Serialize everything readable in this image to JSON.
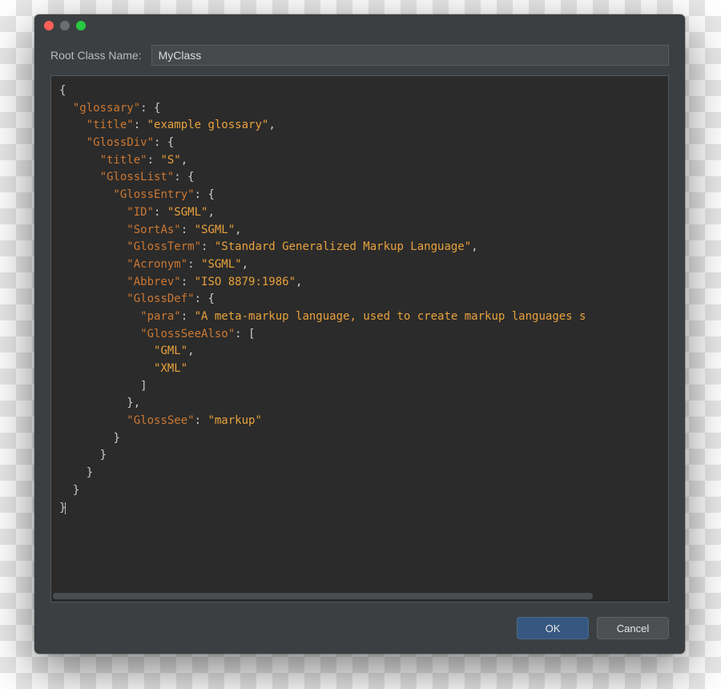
{
  "form": {
    "label": "Root Class Name:",
    "value": "MyClass"
  },
  "editor": {
    "lines": [
      {
        "indent": 0,
        "tokens": [
          {
            "t": "p",
            "v": "{"
          }
        ]
      },
      {
        "indent": 1,
        "tokens": [
          {
            "t": "k",
            "v": "\"glossary\""
          },
          {
            "t": "p",
            "v": ": {"
          }
        ]
      },
      {
        "indent": 2,
        "tokens": [
          {
            "t": "k",
            "v": "\"title\""
          },
          {
            "t": "p",
            "v": ": "
          },
          {
            "t": "s",
            "v": "\"example glossary\""
          },
          {
            "t": "p",
            "v": ","
          }
        ]
      },
      {
        "indent": 2,
        "tokens": [
          {
            "t": "k",
            "v": "\"GlossDiv\""
          },
          {
            "t": "p",
            "v": ": {"
          }
        ]
      },
      {
        "indent": 3,
        "tokens": [
          {
            "t": "k",
            "v": "\"title\""
          },
          {
            "t": "p",
            "v": ": "
          },
          {
            "t": "s",
            "v": "\"S\""
          },
          {
            "t": "p",
            "v": ","
          }
        ]
      },
      {
        "indent": 3,
        "tokens": [
          {
            "t": "k",
            "v": "\"GlossList\""
          },
          {
            "t": "p",
            "v": ": {"
          }
        ]
      },
      {
        "indent": 4,
        "tokens": [
          {
            "t": "k",
            "v": "\"GlossEntry\""
          },
          {
            "t": "p",
            "v": ": {"
          }
        ]
      },
      {
        "indent": 5,
        "tokens": [
          {
            "t": "k",
            "v": "\"ID\""
          },
          {
            "t": "p",
            "v": ": "
          },
          {
            "t": "s",
            "v": "\"SGML\""
          },
          {
            "t": "p",
            "v": ","
          }
        ]
      },
      {
        "indent": 5,
        "tokens": [
          {
            "t": "k",
            "v": "\"SortAs\""
          },
          {
            "t": "p",
            "v": ": "
          },
          {
            "t": "s",
            "v": "\"SGML\""
          },
          {
            "t": "p",
            "v": ","
          }
        ]
      },
      {
        "indent": 5,
        "tokens": [
          {
            "t": "k",
            "v": "\"GlossTerm\""
          },
          {
            "t": "p",
            "v": ": "
          },
          {
            "t": "s",
            "v": "\"Standard Generalized Markup Language\""
          },
          {
            "t": "p",
            "v": ","
          }
        ]
      },
      {
        "indent": 5,
        "tokens": [
          {
            "t": "k",
            "v": "\"Acronym\""
          },
          {
            "t": "p",
            "v": ": "
          },
          {
            "t": "s",
            "v": "\"SGML\""
          },
          {
            "t": "p",
            "v": ","
          }
        ]
      },
      {
        "indent": 5,
        "tokens": [
          {
            "t": "k",
            "v": "\"Abbrev\""
          },
          {
            "t": "p",
            "v": ": "
          },
          {
            "t": "s",
            "v": "\"ISO 8879:1986\""
          },
          {
            "t": "p",
            "v": ","
          }
        ]
      },
      {
        "indent": 5,
        "tokens": [
          {
            "t": "k",
            "v": "\"GlossDef\""
          },
          {
            "t": "p",
            "v": ": {"
          }
        ]
      },
      {
        "indent": 6,
        "tokens": [
          {
            "t": "k",
            "v": "\"para\""
          },
          {
            "t": "p",
            "v": ": "
          },
          {
            "t": "s",
            "v": "\"A meta-markup language, used to create markup languages s"
          }
        ]
      },
      {
        "indent": 6,
        "tokens": [
          {
            "t": "k",
            "v": "\"GlossSeeAlso\""
          },
          {
            "t": "p",
            "v": ": ["
          }
        ]
      },
      {
        "indent": 7,
        "tokens": [
          {
            "t": "s",
            "v": "\"GML\""
          },
          {
            "t": "p",
            "v": ","
          }
        ]
      },
      {
        "indent": 7,
        "tokens": [
          {
            "t": "s",
            "v": "\"XML\""
          }
        ]
      },
      {
        "indent": 6,
        "tokens": [
          {
            "t": "p",
            "v": "]"
          }
        ]
      },
      {
        "indent": 5,
        "tokens": [
          {
            "t": "p",
            "v": "},"
          }
        ]
      },
      {
        "indent": 5,
        "tokens": [
          {
            "t": "k",
            "v": "\"GlossSee\""
          },
          {
            "t": "p",
            "v": ": "
          },
          {
            "t": "s",
            "v": "\"markup\""
          }
        ]
      },
      {
        "indent": 4,
        "tokens": [
          {
            "t": "p",
            "v": "}"
          }
        ]
      },
      {
        "indent": 3,
        "tokens": [
          {
            "t": "p",
            "v": "}"
          }
        ]
      },
      {
        "indent": 2,
        "tokens": [
          {
            "t": "p",
            "v": "}"
          }
        ]
      },
      {
        "indent": 1,
        "tokens": [
          {
            "t": "p",
            "v": "}"
          }
        ]
      },
      {
        "indent": 0,
        "tokens": [
          {
            "t": "p",
            "v": "}"
          }
        ],
        "caret": true
      }
    ]
  },
  "buttons": {
    "ok": "OK",
    "cancel": "Cancel"
  }
}
